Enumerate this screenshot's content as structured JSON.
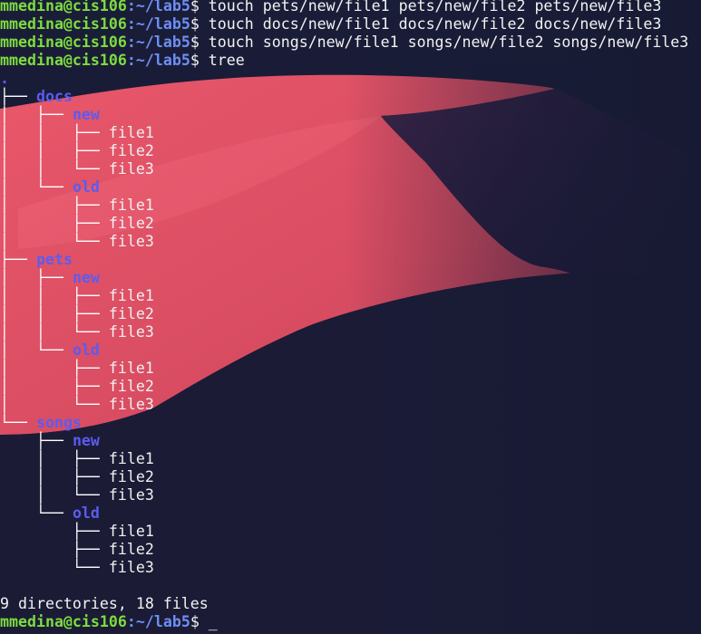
{
  "colors": {
    "background": "#171a33",
    "dune": "#e05466",
    "user": "#7ddc3f",
    "path": "#6d8ff5",
    "directory": "#5b5cf0",
    "text": "#f2f2f2"
  },
  "prompt": {
    "user": "mmedina@cis106",
    "path": ":~/lab5",
    "symbol": "$ "
  },
  "commands": [
    "touch pets/new/file1 pets/new/file2 pets/new/file3",
    "touch docs/new/file1 docs/new/file2 docs/new/file3",
    "touch songs/new/file1 songs/new/file2 songs/new/file3",
    "tree"
  ],
  "tree": {
    "root": ".",
    "directories": [
      {
        "name": "docs",
        "children": [
          {
            "name": "new",
            "files": [
              "file1",
              "file2",
              "file3"
            ]
          },
          {
            "name": "old",
            "files": [
              "file1",
              "file2",
              "file3"
            ]
          }
        ]
      },
      {
        "name": "pets",
        "children": [
          {
            "name": "new",
            "files": [
              "file1",
              "file2",
              "file3"
            ]
          },
          {
            "name": "old",
            "files": [
              "file1",
              "file2",
              "file3"
            ]
          }
        ]
      },
      {
        "name": "songs",
        "children": [
          {
            "name": "new",
            "files": [
              "file1",
              "file2",
              "file3"
            ]
          },
          {
            "name": "old",
            "files": [
              "file1",
              "file2",
              "file3"
            ]
          }
        ]
      }
    ],
    "summary": "9 directories, 18 files"
  },
  "cursor": "_"
}
